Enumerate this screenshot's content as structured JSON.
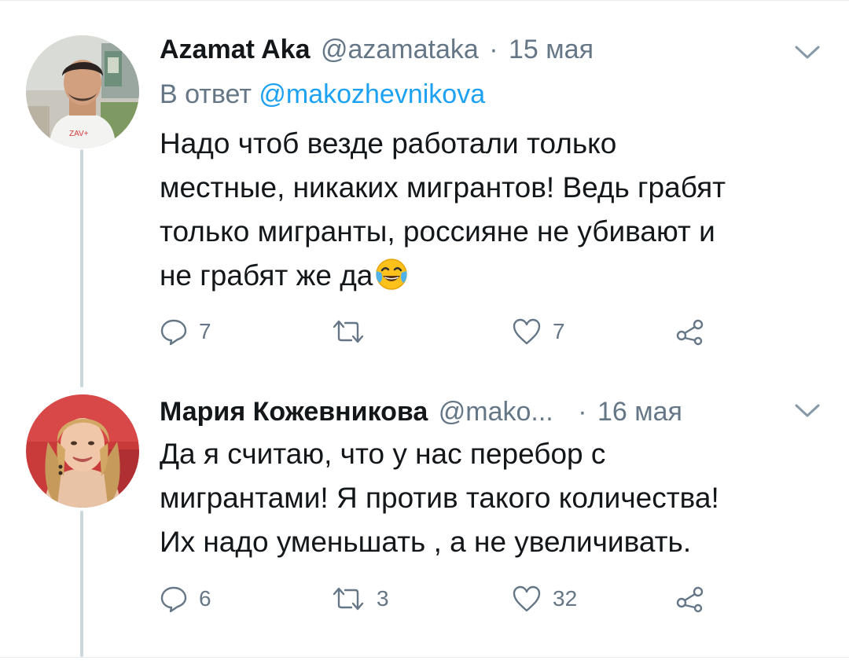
{
  "tweets": [
    {
      "name": "Azamat Aka",
      "handle": "@azamataka",
      "separator": "·",
      "date": "15 мая",
      "reply_prefix": "В ответ",
      "reply_mention": "@makozhevnikova",
      "text_lines": [
        "Надо чтоб везде работали только",
        "местные, никаких мигрантов! Ведь грабят",
        "только мигранты, россияне не убивают и",
        "не грабят же да"
      ],
      "emoji": "face-with-tears-of-joy",
      "actions": {
        "reply_count": "7",
        "retweet_count": "",
        "like_count": "7"
      }
    },
    {
      "name": "Мария Кожевникова",
      "handle": "@mako...",
      "separator": "·",
      "date": "16 мая",
      "text_lines": [
        "Да я считаю, что у нас перебор с",
        "мигрантами! Я против такого количества!",
        "Их надо уменьшать , а не увеличивать."
      ],
      "actions": {
        "reply_count": "6",
        "retweet_count": "3",
        "like_count": "32"
      }
    }
  ],
  "icons": {
    "reply": "reply-icon",
    "retweet": "retweet-icon",
    "like": "heart-icon",
    "share": "share-icon",
    "caret": "chevron-down-icon"
  },
  "colors": {
    "text": "#14171a",
    "secondary": "#657786",
    "link": "#1da1f2",
    "thread_line": "#ccd6dd"
  }
}
